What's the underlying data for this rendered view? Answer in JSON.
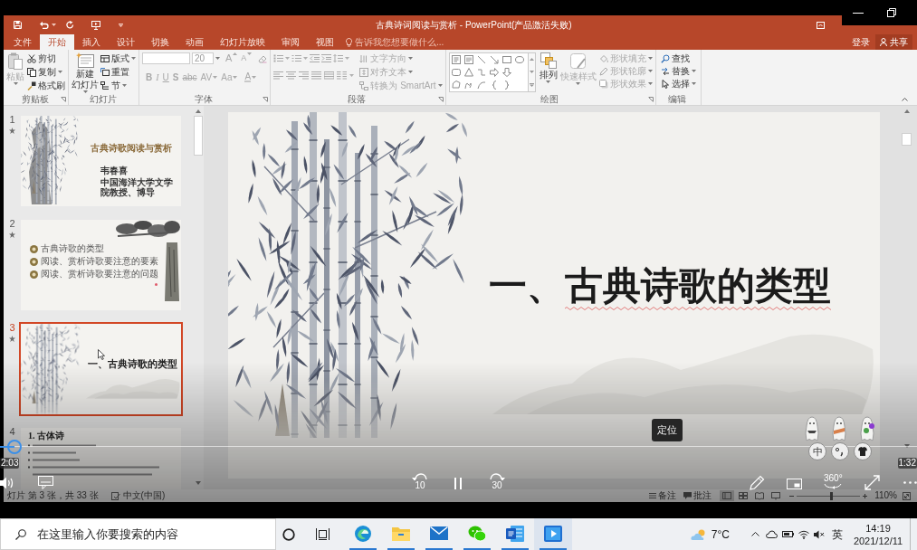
{
  "title_bar": {
    "title": "古典诗词阅读与赏析 - PowerPoint(产品激活失败)"
  },
  "tabs": [
    {
      "label": "文件",
      "selected": false
    },
    {
      "label": "开始",
      "selected": true
    },
    {
      "label": "插入",
      "selected": false
    },
    {
      "label": "设计",
      "selected": false
    },
    {
      "label": "切换",
      "selected": false
    },
    {
      "label": "动画",
      "selected": false
    },
    {
      "label": "幻灯片放映",
      "selected": false
    },
    {
      "label": "审阅",
      "selected": false
    },
    {
      "label": "视图",
      "selected": false
    }
  ],
  "tell_me": {
    "placeholder": "告诉我您想要做什么..."
  },
  "account": {
    "sign_in": "登录",
    "share": "共享"
  },
  "ribbon": {
    "groups": [
      {
        "label": "剪贴板",
        "commands": [
          {
            "label": "粘贴",
            "disabled": true
          },
          {
            "label": "剪切",
            "disabled": false
          },
          {
            "label": "复制",
            "disabled": false
          },
          {
            "label": "格式刷",
            "disabled": false
          }
        ]
      },
      {
        "label": "幻灯片",
        "commands": [
          {
            "lines": [
              "新建",
              "幻灯片"
            ],
            "disabled": false
          },
          {
            "label": "版式",
            "disabled": false
          },
          {
            "label": "重置",
            "disabled": false
          },
          {
            "label": "节",
            "disabled": false
          }
        ]
      },
      {
        "label": "字体",
        "font_size": "20",
        "commands": [
          {
            "label": "A",
            "disabled": true
          },
          {
            "label": "A",
            "disabled": true
          },
          {
            "label": "B",
            "disabled": true
          },
          {
            "label": "I",
            "disabled": true
          },
          {
            "label": "U",
            "disabled": true
          },
          {
            "label": "S",
            "disabled": true
          },
          {
            "label": "abc",
            "disabled": true
          },
          {
            "label": "AV",
            "disabled": true
          },
          {
            "label": "Aa",
            "disabled": true
          },
          {
            "label": "A",
            "disabled": true
          }
        ]
      },
      {
        "label": "段落",
        "commands": [
          {
            "label": "文字方向",
            "disabled": true
          },
          {
            "label": "对齐文本",
            "disabled": true
          },
          {
            "label": "转换为 SmartArt",
            "disabled": true
          }
        ]
      },
      {
        "label": "绘图",
        "commands": [
          {
            "label": "排列",
            "disabled": false
          },
          {
            "label": "快速样式",
            "disabled": true
          },
          {
            "label": "形状填充",
            "disabled": true
          },
          {
            "label": "形状轮廓",
            "disabled": true
          },
          {
            "label": "形状效果",
            "disabled": true
          }
        ]
      },
      {
        "label": "编辑",
        "commands": [
          {
            "label": "查找",
            "disabled": false
          },
          {
            "label": "替换",
            "disabled": false
          },
          {
            "label": "选择",
            "disabled": false
          }
        ]
      }
    ]
  },
  "slides_panel": {
    "slides": [
      {
        "number": "1",
        "kind": "title",
        "selected": false,
        "animated": true,
        "title": "古典诗歌阅读与赏析",
        "author": "韦春喜",
        "affiliation": "中国海洋大学文学院教授、博导"
      },
      {
        "number": "2",
        "kind": "contents",
        "selected": false,
        "animated": true,
        "items": [
          "古典诗歌的类型",
          "阅读、赏析诗歌要注意的要素",
          "阅读、赏析诗歌要注意的问题"
        ]
      },
      {
        "number": "3",
        "kind": "section",
        "selected": true,
        "animated": true,
        "title": "一、古典诗歌的类型"
      },
      {
        "number": "4",
        "kind": "text",
        "selected": false,
        "animated": false,
        "title": "1. 古体诗"
      }
    ]
  },
  "slide": {
    "title": "一、古典诗歌的类型"
  },
  "status_bar": {
    "slide_info": "灯片 第 3 张，共 33 张",
    "language": "中文(中国)",
    "notes": "备注",
    "comments": "批注",
    "views": [
      {
        "selected": true
      },
      {
        "selected": false
      },
      {
        "selected": false
      },
      {
        "selected": false
      }
    ],
    "zoom_slider": {
      "level": 0.55
    },
    "zoom": "110%"
  },
  "player": {
    "elapsed": "2:03",
    "remaining": "1:32",
    "progress": {
      "level": 0.016
    },
    "tooltip": "定位",
    "playing": true,
    "skip_back": "10",
    "skip_forward": "30",
    "vr": "360°"
  },
  "ime_toolbar": {
    "mode": "中"
  },
  "taskbar": {
    "search": {
      "placeholder": "在这里输入你要搜索的内容"
    },
    "apps": [
      {
        "kind": "edge",
        "running": true,
        "selected": false
      },
      {
        "kind": "explorer",
        "running": true,
        "selected": false
      },
      {
        "kind": "mail",
        "running": true,
        "selected": false
      },
      {
        "kind": "wechat",
        "running": true,
        "selected": false
      },
      {
        "kind": "word",
        "running": true,
        "selected": false
      },
      {
        "kind": "player",
        "running": true,
        "selected": true
      }
    ],
    "weather": "7°C",
    "input_language": "英",
    "time": "14:19",
    "date": "2021/12/11"
  }
}
